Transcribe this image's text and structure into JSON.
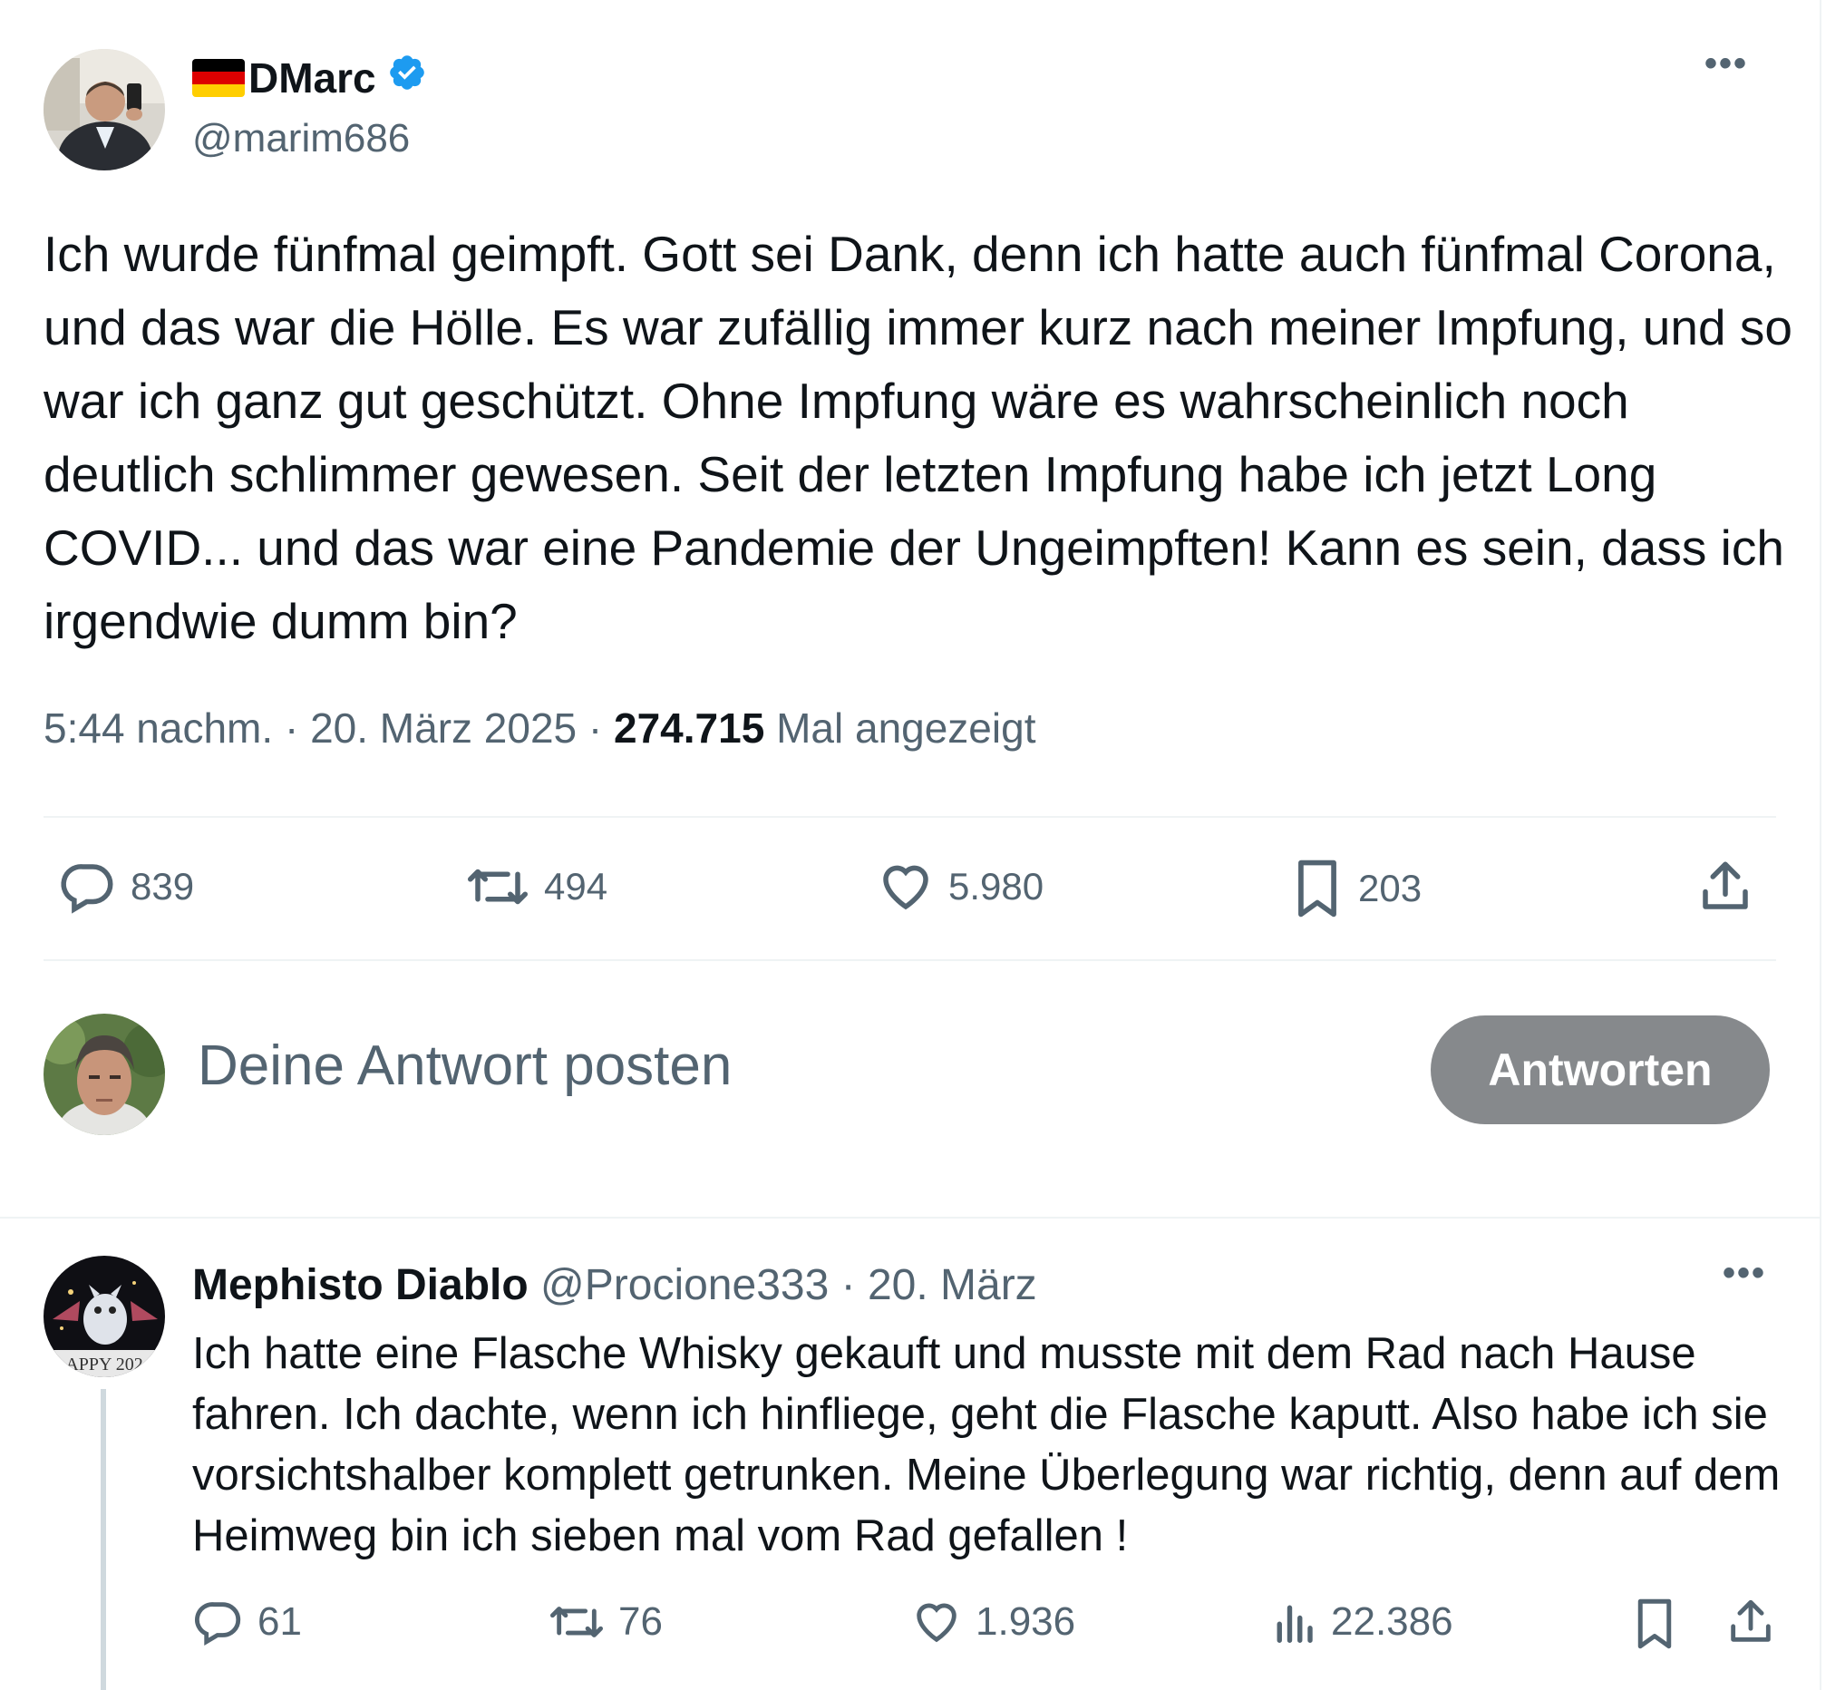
{
  "main_tweet": {
    "display_name": "DMarc",
    "handle": "@marim686",
    "more_label": "•••",
    "text": "Ich wurde fünfmal geimpft. Gott sei Dank, denn ich hatte auch fünfmal Corona, und das war die Hölle. Es war zufällig immer kurz nach meiner Impfung, und so war ich ganz gut geschützt. Ohne Impfung wäre es wahrscheinlich noch deutlich schlimmer gewesen. Seit der letzten Impfung habe ich jetzt Long COVID... und das war eine Pandemie der Ungeimpften! Kann es sein, dass ich irgendwie dumm bin?",
    "time": "5:44 nachm.",
    "date": "20. März 2025",
    "separator": "·",
    "views_count": "274.715",
    "views_label": "Mal angezeigt",
    "actions": {
      "replies": "839",
      "reposts": "494",
      "likes": "5.980",
      "bookmarks": "203"
    }
  },
  "composer": {
    "placeholder": "Deine Antwort posten",
    "button_label": "Antworten"
  },
  "reply": {
    "display_name": "Mephisto Diablo",
    "handle": "@Procione333",
    "separator": "·",
    "date": "20. März",
    "more_label": "•••",
    "text": "Ich hatte eine Flasche Whisky gekauft und musste mit dem Rad nach Hause fahren. Ich dachte, wenn ich hinfliege, geht die Flasche kaputt. Also habe ich sie vorsichtshalber komplett getrunken. Meine Überlegung war richtig, denn auf dem Heimweg bin ich sieben mal vom Rad gefallen !",
    "avatar_text": "APPY 202",
    "actions": {
      "replies": "61",
      "reposts": "76",
      "likes": "1.936",
      "views": "22.386"
    }
  },
  "colors": {
    "text": "#0f1419",
    "secondary": "#536471",
    "verified": "#1d9bf0",
    "button_disabled": "#86898c",
    "divider": "#eff3f4",
    "flag_black": "#000000",
    "flag_red": "#dd0000",
    "flag_gold": "#ffce00"
  },
  "icons": [
    "flag-germany-icon",
    "verified-badge-icon",
    "more-icon",
    "reply-icon",
    "repost-icon",
    "like-icon",
    "bookmark-icon",
    "share-icon",
    "views-icon"
  ]
}
